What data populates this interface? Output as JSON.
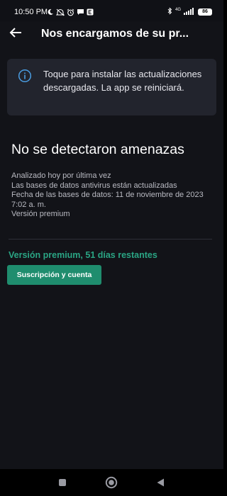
{
  "status_bar": {
    "time": "10:50 PM",
    "network_label": "4G",
    "battery_level": "86",
    "left_icons": [
      "moon-icon",
      "mute-icon",
      "alarm-icon",
      "message-icon",
      "app-e-icon"
    ],
    "right_icons": [
      "bluetooth-icon",
      "signal-icon",
      "battery-icon"
    ]
  },
  "header": {
    "title": "Nos encargamos de su pr..."
  },
  "info_banner": {
    "icon": "info-icon",
    "text": "Toque para instalar las actualizaciones descargadas. La app se reiniciará."
  },
  "main": {
    "headline": "No se detectaron amenazas",
    "details": [
      "Analizado hoy por última vez",
      "Las bases de datos antivirus están actualizadas",
      "Fecha de las bases de datos: 11 de noviembre de 2023",
      "7:02 a. m.",
      "Versión premium"
    ],
    "premium_status": "Versión premium, 51 días restantes",
    "subscription_button": "Suscripción y cuenta"
  },
  "navigation": {
    "icons": [
      "recents-icon",
      "home-icon",
      "back-icon"
    ]
  },
  "colors": {
    "background": "#121318",
    "banner_background": "#22242d",
    "accent_green": "#2aa584",
    "button_green": "#1f8d6e",
    "info_blue": "#4a9de2"
  }
}
